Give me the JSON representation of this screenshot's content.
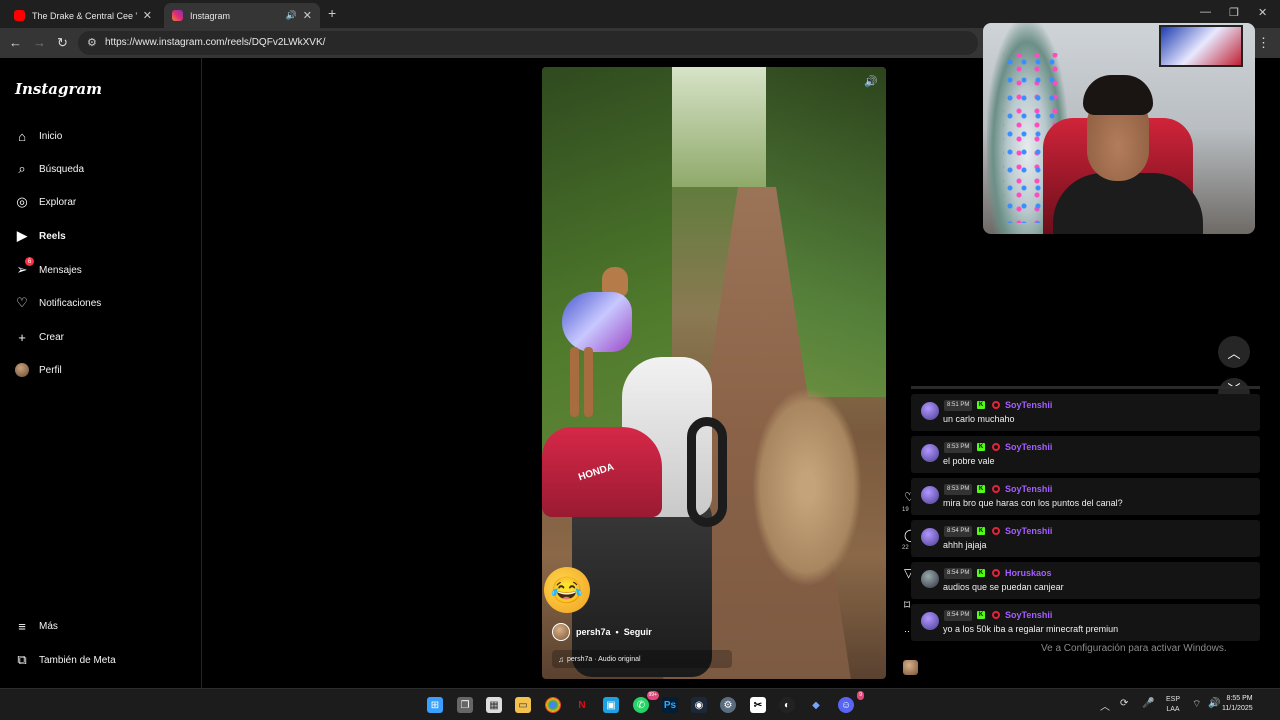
{
  "browser": {
    "tabs": [
      {
        "title": "The Drake & Central Cee \"On T",
        "favicon": "youtube-icon",
        "active": false
      },
      {
        "title": "Instagram",
        "favicon": "instagram-icon",
        "active": true
      }
    ],
    "url": "https://www.instagram.com/reels/DQFv2LWkXVK/"
  },
  "sidebar": {
    "logo": "Instagram",
    "items": [
      {
        "label": "Inicio",
        "icon": "home-icon"
      },
      {
        "label": "Búsqueda",
        "icon": "search-icon"
      },
      {
        "label": "Explorar",
        "icon": "compass-icon"
      },
      {
        "label": "Reels",
        "icon": "reels-icon"
      },
      {
        "label": "Mensajes",
        "icon": "messages-icon",
        "badge": "6"
      },
      {
        "label": "Notificaciones",
        "icon": "heart-icon"
      },
      {
        "label": "Crear",
        "icon": "plus-icon"
      },
      {
        "label": "Perfil",
        "icon": "profile-avatar"
      }
    ],
    "bottom": [
      {
        "label": "Más",
        "icon": "menu-icon"
      },
      {
        "label": "También de Meta",
        "icon": "meta-icon"
      }
    ]
  },
  "reel": {
    "username": "persh7a",
    "follow_label": "Seguir",
    "audio": "persh7a · Audio original",
    "like_count": "19",
    "comment_count": "22",
    "overlay_text": "HONDA"
  },
  "chat": {
    "messages": [
      {
        "time": "8:51 PM",
        "user": "SoyTenshii",
        "text": "un carlo muchaho"
      },
      {
        "time": "8:53 PM",
        "user": "SoyTenshii",
        "text": "el pobre vale"
      },
      {
        "time": "8:53 PM",
        "user": "SoyTenshii",
        "text": "mira bro que haras con los puntos del canal?"
      },
      {
        "time": "8:54 PM",
        "user": "SoyTenshii",
        "text": "ahhh jajaja"
      },
      {
        "time": "8:54 PM",
        "user": "Horuskaos",
        "text": "audios que se puedan canjear"
      },
      {
        "time": "8:54 PM",
        "user": "SoyTenshii",
        "text": "yo a los 50k iba a regalar minecraft premiun"
      }
    ],
    "username_color": "#a45dff"
  },
  "windows_watermark": "Ve a Configuración para activar Windows.",
  "taskbar": {
    "language": "ESP",
    "layout": "LAA",
    "time": "8:55 PM",
    "date": "11/1/2025",
    "whatsapp_badge": "99+",
    "discord_badge": "9"
  }
}
